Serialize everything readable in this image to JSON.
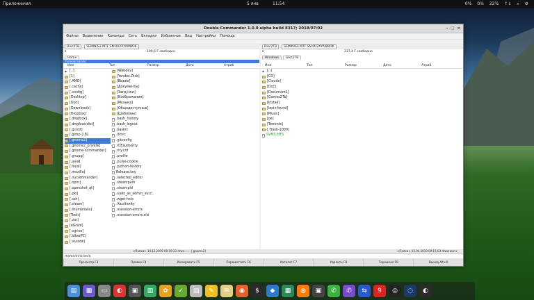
{
  "topbar": {
    "apps": "Приложения",
    "date": "5 янв",
    "time": "11:54",
    "tray": [
      "0%",
      "0%",
      "22%",
      "↑↓",
      "⌕",
      "⚙"
    ]
  },
  "window": {
    "title": "Double Commander 1.0.0 alpha build 8317; 2018/07/02"
  },
  "menu": [
    "Файлы",
    "Выделение",
    "Команды",
    "Сеть",
    "Вкладки",
    "Избранное",
    "Вид",
    "Настройки",
    "Помощь"
  ],
  "left": {
    "drive": "Disc2TB",
    "drive2": "SEMINIS3 MTF SN.0U2XYAWBOK",
    "path_free": "199,6 Г свободно",
    "tab": "Home",
    "pathline": "/home/irinkrim/",
    "cols": [
      "Имя",
      "Тип",
      "Размер",
      "Дата",
      "Атриб"
    ],
    "col1": [
      "[..]",
      "[1]",
      "[.AMD]",
      "[.cache]",
      "[.config]",
      "[Desktop]",
      "[Doc]",
      "[Downloads]",
      "[Dropbox]",
      "[.dropbox]",
      "[.dropbox-dist]",
      "[.gconf]",
      "[.gimp-2.8]",
      "[.gnome2]",
      "[.gnome2_private]",
      "[.gnome-commander]",
      "[.gnupg]",
      "[.java]",
      "[.local]",
      "[.mozilla]",
      "[.nucommander]",
      "[.npm]",
      "[.openshot_qt]",
      "[.pki]",
      "[.ssh]",
      "[.steam]",
      "[.thumbnails]",
      "[Tools]",
      "[.var]",
      "[eGrive]",
      "[.vgrive]",
      "[.ViberPC]",
      "[.vscode]"
    ],
    "col2": [
      "[Webdev]",
      "[Yandex.Disk]",
      "[Видео]",
      "[Документы]",
      "[Загрузки]",
      "[Изображения]",
      "[Музыка]",
      "[Общедоступные]",
      "[Шаблоны]",
      ".bash_history",
      ".bash_logout",
      ".bashrc",
      ".dmrc",
      ".gitconfig",
      ".ICEauthority",
      ".my.cnf",
      ".profile",
      ".pulse-cookie",
      ".python-history",
      "Release.key",
      ".selected_editor",
      ".steampath",
      ".steampid",
      ".sudo_as_admin_succ..",
      ".wget-hsts",
      ".Xauthority",
      ".xsession-errors",
      ".xsession-errors.old"
    ],
    "status": "<Папка> 14.12.2019 09:19:33 drwx------ [.gnome2]"
  },
  "right": {
    "drive": "Disc2TB",
    "drive2": "SEMINIS3 MTF SN.0U2XYAWBOK",
    "path_free": "237,4 Г свободно",
    "tabs": [
      "Windows",
      "Disc2TB"
    ],
    "cols": [
      "Имя",
      "Тип",
      "Размер",
      "Дата",
      "Атриб"
    ],
    "rows": [
      "[..]",
      "[CD]",
      "[Clouds]",
      "[Doc]",
      "[Document1]",
      "[Games2Tb]",
      "[Install]",
      "[lost+found]",
      "[Music]",
      "[oe]",
      "[Torrents]",
      "[.Trash-1000]",
      "SVMS.MTS"
    ],
    "status": "<Папка> 02.04.2019 09:15:03 drwxrwxr-x"
  },
  "cmdline": "/home/irinkrim/$",
  "fkeys": [
    "Просмотр F3",
    "Правка F4",
    "Копировать F5",
    "Переместить F6",
    "Каталог F7",
    "Удалить F8",
    "Терминал F9",
    "Выход Alt+X"
  ]
}
